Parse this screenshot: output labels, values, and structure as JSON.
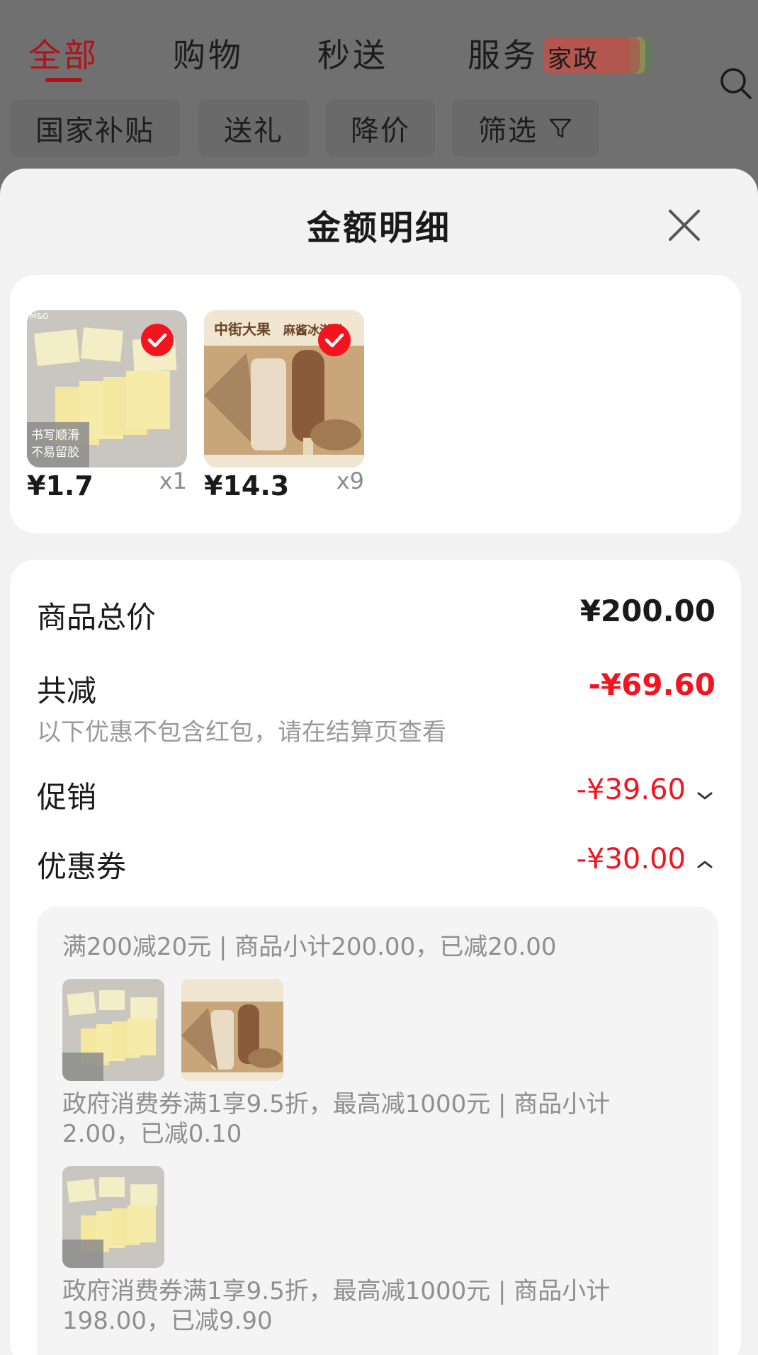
{
  "top_tabs": {
    "all": "全部",
    "shopping": "购物",
    "express": "秒送",
    "service": "服务",
    "service_tag": "家政"
  },
  "filter_chips": {
    "subsidy": "国家补贴",
    "gift": "送礼",
    "price_drop": "降价",
    "filter": "筛选"
  },
  "sheet": {
    "title": "金额明细"
  },
  "items": [
    {
      "product_text_1": "书写顺滑",
      "product_text_2": "不易留胶",
      "brand_mark": "M&G",
      "price": "¥1.7",
      "qty": "x1",
      "selected": true
    },
    {
      "product_text_1": "中街大果",
      "product_text_2": "麻酱冰淇淋",
      "price": "¥14.3",
      "qty": "x9",
      "selected": true
    }
  ],
  "details": {
    "total_label": "商品总价",
    "total_value": "¥200.00",
    "discount_label": "共减",
    "discount_value": "-¥69.60",
    "discount_note": "以下优惠不包含红包，请在结算页查看",
    "promo_label": "促销",
    "promo_value": "-¥39.60",
    "coupon_label": "优惠券",
    "coupon_value": "-¥30.00",
    "coupon_lines": {
      "line1": "满200减20元 | 商品小计200.00，已减20.00",
      "line2a": "政府消费券满1享9.5折，最高减1000元 | 商品小计",
      "line2b": "2.00，已减0.10",
      "line3a": "政府消费券满1享9.5折，最高减1000元 | 商品小计",
      "line3b": "198.00，已减9.90"
    }
  },
  "colors": {
    "accent_red": "#f2151f",
    "tab_active": "#b0131a",
    "sticky_note": "#f4e8a0",
    "icecream_bg": "#c9a57a"
  }
}
